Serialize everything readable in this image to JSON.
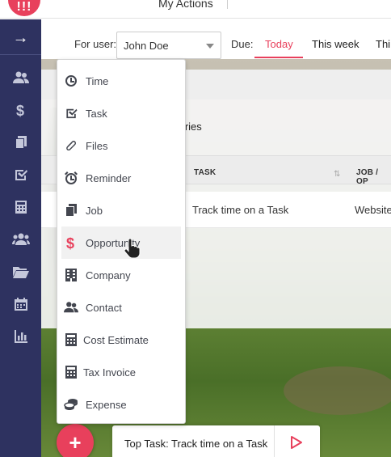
{
  "app": {
    "logo_text": "!!!",
    "brand_color": "#e8405c",
    "sidebar_color": "#2e3260"
  },
  "header": {
    "title": "My Actions"
  },
  "filter": {
    "for_user_label": "For user:",
    "user_value": "John Doe",
    "due_label": "Due:",
    "due_tabs": [
      "Today",
      "This week",
      "Thi"
    ],
    "active_tab": "Today"
  },
  "sidebar": {
    "items": [
      "expand-arrow",
      "contacts",
      "dollar",
      "files",
      "tasks",
      "calculator",
      "team",
      "folder",
      "calendar",
      "reports"
    ]
  },
  "table": {
    "entries_text": "ntries",
    "columns": [
      "TASK",
      "JOB / OP"
    ],
    "rows": [
      {
        "task": "Track time on a Task",
        "job": "Website"
      }
    ]
  },
  "menu": {
    "items": [
      {
        "label": "Time",
        "icon": "clock-icon"
      },
      {
        "label": "Task",
        "icon": "task-check-icon"
      },
      {
        "label": "Files",
        "icon": "paperclip-icon"
      },
      {
        "label": "Reminder",
        "icon": "alarm-icon"
      },
      {
        "label": "Job",
        "icon": "job-icon"
      },
      {
        "label": "Opportunity",
        "icon": "dollar-icon"
      },
      {
        "label": "Company",
        "icon": "building-icon"
      },
      {
        "label": "Contact",
        "icon": "contacts-icon"
      },
      {
        "label": "Cost Estimate",
        "icon": "calculator-icon"
      },
      {
        "label": "Tax Invoice",
        "icon": "calculator-icon"
      },
      {
        "label": "Expense",
        "icon": "coins-icon"
      }
    ],
    "hovered": "Opportunity"
  },
  "bottom": {
    "fab_label": "+",
    "top_task_text": "Top Task: Track time on a Task"
  }
}
